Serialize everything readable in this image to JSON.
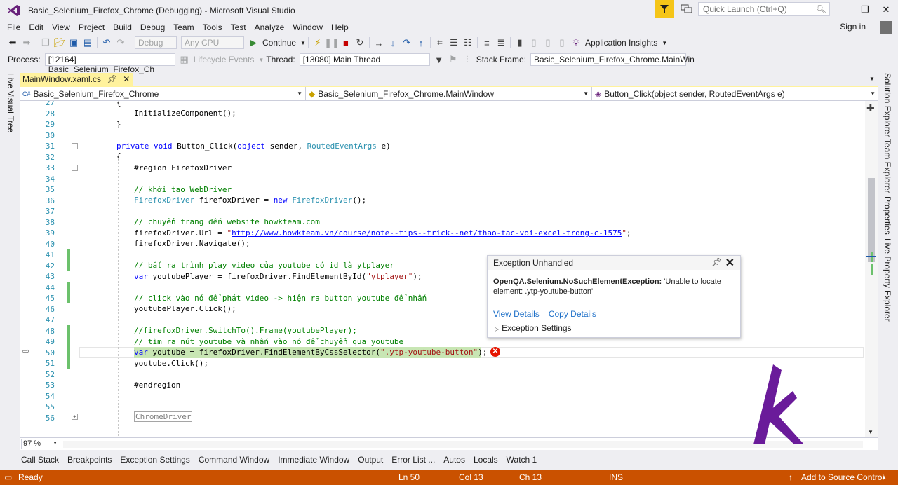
{
  "window": {
    "title": "Basic_Selenium_Firefox_Chrome (Debugging) - Microsoft Visual Studio",
    "quick_launch_placeholder": "Quick Launch (Ctrl+Q)"
  },
  "menu": [
    "File",
    "Edit",
    "View",
    "Project",
    "Build",
    "Debug",
    "Team",
    "Tools",
    "Test",
    "Analyze",
    "Window",
    "Help"
  ],
  "signin_label": "Sign in",
  "toolbar1": {
    "config": "Debug",
    "platform": "Any CPU",
    "continue_label": "Continue",
    "app_insights_label": "Application Insights"
  },
  "toolbar2": {
    "process_label": "Process:",
    "process_value": "[12164] Basic_Selenium_Firefox_Ch",
    "lifecycle_label": "Lifecycle Events",
    "thread_label": "Thread:",
    "thread_value": "[13080] Main Thread",
    "stackframe_label": "Stack Frame:",
    "stackframe_value": "Basic_Selenium_Firefox_Chrome.MainWin"
  },
  "left_tool": "Live Visual Tree",
  "right_tools": [
    "Solution Explorer",
    "Team Explorer",
    "Properties",
    "Live Property Explorer"
  ],
  "doc_tab": {
    "label": "MainWindow.xaml.cs"
  },
  "navbar": {
    "project": "Basic_Selenium_Firefox_Chrome",
    "class": "Basic_Selenium_Firefox_Chrome.MainWindow",
    "member": "Button_Click(object sender, RoutedEventArgs e)"
  },
  "editor": {
    "line_numbers": [
      "27",
      "28",
      "29",
      "30",
      "31",
      "32",
      "33",
      "34",
      "35",
      "36",
      "37",
      "38",
      "39",
      "40",
      "41",
      "42",
      "43",
      "44",
      "45",
      "46",
      "47",
      "48",
      "49",
      "50",
      "51",
      "52",
      "53",
      "54",
      "55",
      "56"
    ],
    "code": {
      "l27": "{",
      "l28": "InitializeComponent();",
      "l29": "}",
      "l31_kw1": "private",
      "l31_kw2": "void",
      "l31_name": "Button_Click(",
      "l31_kw3": "object",
      "l31_mid": "sender,",
      "l31_ty": "RoutedEventArgs",
      "l31_end": "e)",
      "l32": "{",
      "l33": "#region FirefoxDriver",
      "l35": "// khởi tạo WebDriver",
      "l36_ty": "FirefoxDriver",
      "l36_mid": "firefoxDriver = ",
      "l36_kw": "new",
      "l36_ty2": "FirefoxDriver",
      "l36_end": "();",
      "l38": "// chuyển trang đến website howkteam.com",
      "l39_a": "firefoxDriver.Url = ",
      "l39_q1": "\"",
      "l39_link": "http://www.howkteam.vn/course/note--tips--trick--net/thao-tac-voi-excel-trong-c-1575",
      "l39_q2": "\"",
      "l39_end": ";",
      "l40": "firefoxDriver.Navigate();",
      "l42": "// bắt ra trình play video của youtube có id là ytplayer",
      "l43_kw": "var",
      "l43_mid": " youtubePlayer = firefoxDriver.FindElementById(",
      "l43_str": "\"ytplayer\"",
      "l43_end": ");",
      "l45": "// click vào nó để phát video -> hiện ra button youtube để nhấn",
      "l46": "youtubePlayer.Click();",
      "l48": "//firefoxDriver.SwitchTo().Frame(youtubePlayer);",
      "l49": "// tìm ra nút youtube và nhấn vào nó để chuyển qua youtube",
      "l50_kw": "var",
      "l50_mid": " youtube = firefoxDriver.FindElementByCssSelector(",
      "l50_str": "\".ytp-youtube-button\"",
      "l50_end": ");",
      "l51": "youtube.Click();",
      "l53": "#endregion",
      "l56": "ChromeDriver"
    }
  },
  "exception": {
    "header": "Exception Unhandled",
    "type": "OpenQA.Selenium.NoSuchElementException:",
    "message_1": "'Unable to locate",
    "message_2": "element: .ytp-youtube-button'",
    "view_details": "View Details",
    "copy_details": "Copy Details",
    "settings": "Exception Settings"
  },
  "zoom": "97 %",
  "bottom_tabs": [
    "Call Stack",
    "Breakpoints",
    "Exception Settings",
    "Command Window",
    "Immediate Window",
    "Output",
    "Error List ...",
    "Autos",
    "Locals",
    "Watch 1"
  ],
  "status": {
    "ready": "Ready",
    "ln": "Ln 50",
    "col": "Col 13",
    "ch": "Ch 13",
    "ins": "INS",
    "source_control": "Add to Source Control"
  },
  "colors": {
    "status_bar": "#ca5100",
    "doc_tab": "#fff29d",
    "logo": "#6a1b9a",
    "error": "#e51400"
  }
}
